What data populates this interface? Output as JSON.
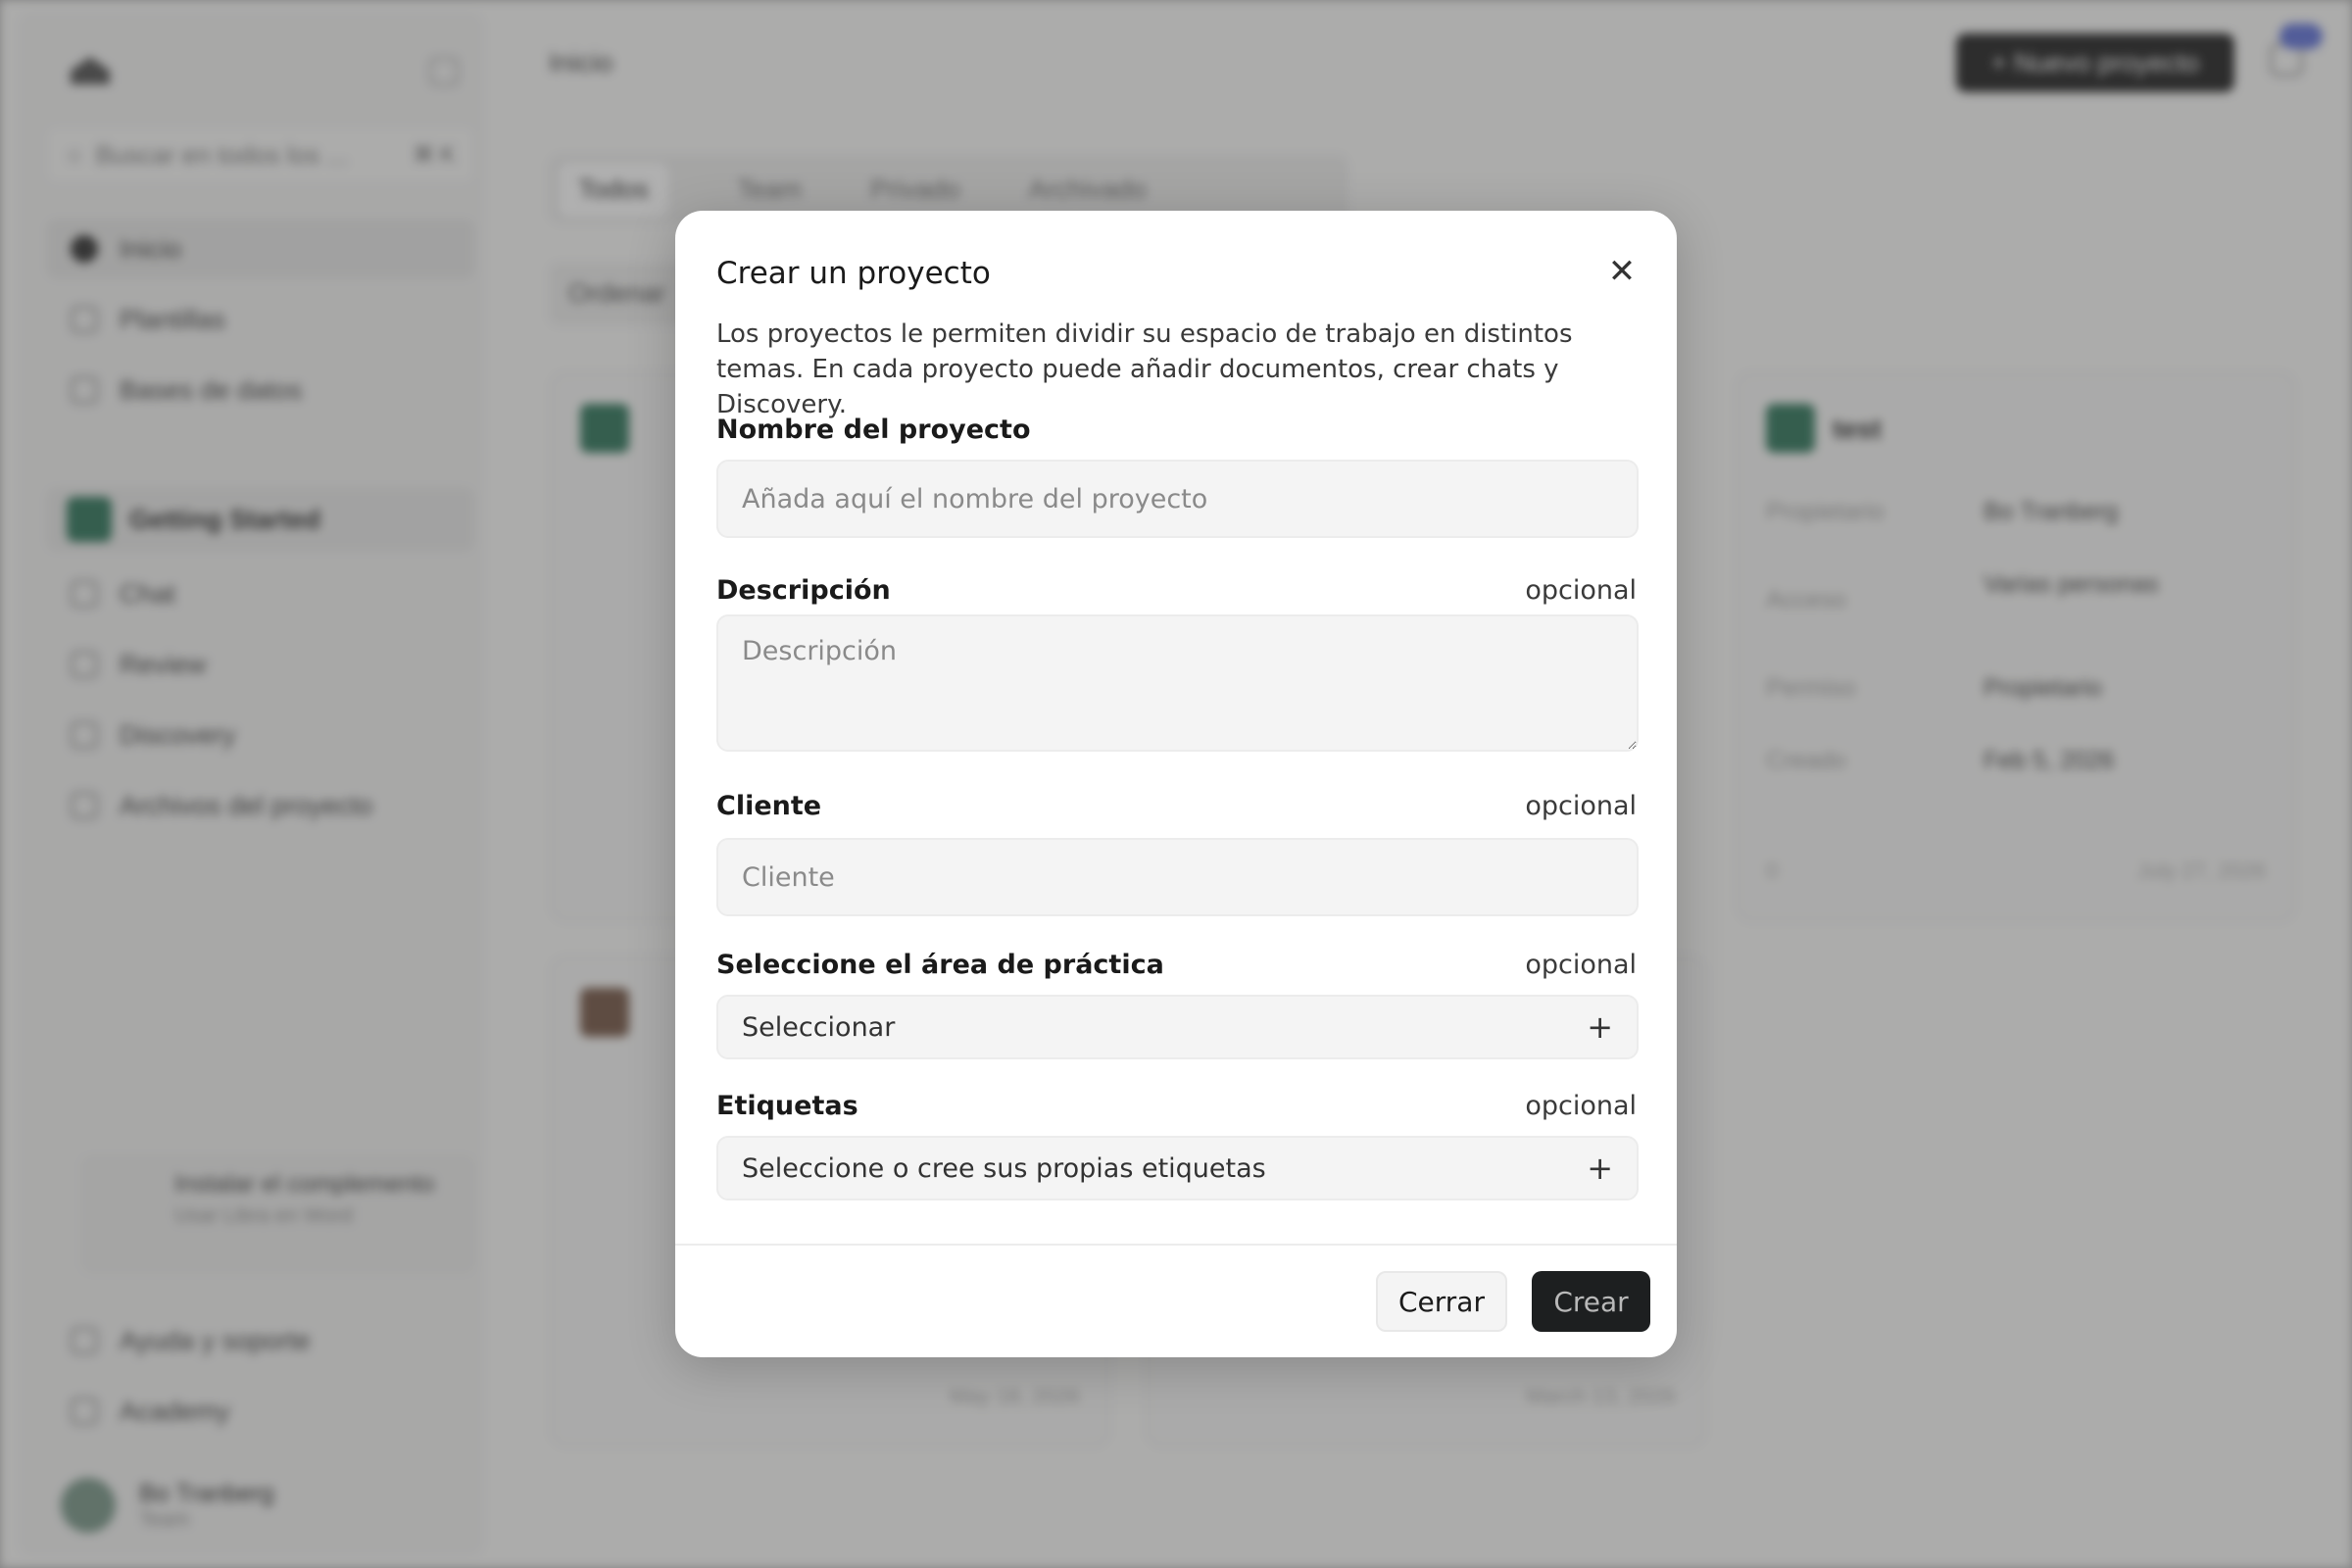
{
  "background": {
    "sidebar": {
      "search_placeholder": "Buscar en todos los ...",
      "search_shortcut": "⌘ K",
      "nav_items": [
        {
          "label": "Inicio"
        },
        {
          "label": "Plantillas"
        },
        {
          "label": "Bases de datos"
        }
      ],
      "project_name": "Getting Started",
      "project_items": [
        {
          "label": "Chat"
        },
        {
          "label": "Review"
        },
        {
          "label": "Discovery"
        },
        {
          "label": "Archivos del proyecto"
        }
      ],
      "install_card": {
        "title": "Instalar el complemento",
        "subtitle": "Usar Libra en Word"
      },
      "footer_items": [
        {
          "label": "Ayuda y soporte"
        },
        {
          "label": "Academy"
        }
      ],
      "user": {
        "name": "Bo Tranberg",
        "role": "Team"
      }
    },
    "header": {
      "breadcrumb": "Inicio",
      "new_project_label": "+ Nuevo proyecto"
    },
    "tabs": [
      {
        "label": "Todos"
      },
      {
        "label": "Team"
      },
      {
        "label": "Privado"
      },
      {
        "label": "Archivado"
      }
    ],
    "order_label": "Ordenar",
    "card": {
      "title": "test",
      "owner_label": "Propietario",
      "owner_value": "Bo Tranberg",
      "access_label": "Acceso",
      "access_value": "Varias personas",
      "permission_label": "Permiso",
      "permission_value": "Propietario",
      "created_label": "Creado",
      "created_value": "Feb 5, 2026",
      "footer_count": "0",
      "footer_date": "July 27, 2026"
    },
    "footer_dates": [
      "May 18, 2026",
      "March 13, 2026"
    ]
  },
  "modal": {
    "title": "Crear un proyecto",
    "description": "Los proyectos le permiten dividir su espacio de trabajo en distintos temas. En cada proyecto puede añadir documentos, crear chats y Discovery.",
    "fields": {
      "name": {
        "label": "Nombre del proyecto",
        "placeholder": "Añada aquí el nombre del proyecto",
        "value": ""
      },
      "description": {
        "label": "Descripción",
        "optional": "opcional",
        "placeholder": "Descripción",
        "value": ""
      },
      "client": {
        "label": "Cliente",
        "optional": "opcional",
        "placeholder": "Cliente",
        "value": ""
      },
      "practice_area": {
        "label": "Seleccione el área de práctica",
        "optional": "opcional",
        "value": "Seleccionar"
      },
      "tags": {
        "label": "Etiquetas",
        "optional": "opcional",
        "value": "Seleccione o cree sus propias etiquetas"
      }
    },
    "buttons": {
      "close": "Cerrar",
      "create": "Crear"
    }
  }
}
